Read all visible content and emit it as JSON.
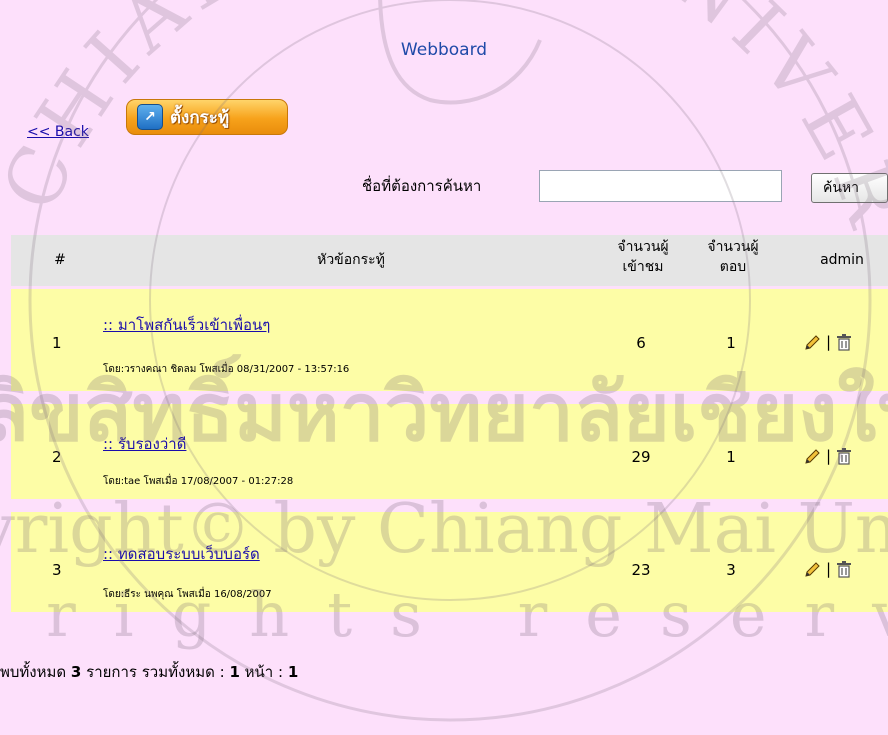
{
  "page": {
    "title": "Webboard",
    "back_label": "<< Back",
    "new_topic_label": "ตั้งกระทู้"
  },
  "search": {
    "label": "ชื่อที่ต้องการค้นหา",
    "value": "",
    "placeholder": "",
    "button_label": "ค้นหา"
  },
  "table": {
    "headers": {
      "number": "#",
      "topic": "หัวข้อกระทู้",
      "views_line1": "จำนวนผู้",
      "views_line2": "เข้าชม",
      "replies_line1": "จำนวนผู้",
      "replies_line2": "ตอบ",
      "admin": "admin"
    },
    "rows": [
      {
        "number": "1",
        "title": ":: มาโพสกันเร็วเข้าเพื่อนๆ",
        "meta": "โดย:วรางคณา ชิดลม โพสเมื่อ 08/31/2007 - 13:57:16",
        "views": "6",
        "replies": "1"
      },
      {
        "number": "2",
        "title": ":: รับรองว่าดี",
        "meta": "โดย:tae โพสเมื่อ 17/08/2007 - 01:27:28",
        "views": "29",
        "replies": "1"
      },
      {
        "number": "3",
        "title": ":: ทดสอบระบบเว็บบอร์ด",
        "meta": "โดย:ธีระ นพคุณ โพสเมื่อ 16/08/2007",
        "views": "23",
        "replies": "3"
      }
    ],
    "action_separator": "|"
  },
  "summary": {
    "prefix": "พบทั้งหมด",
    "count": "3",
    "mid": "รายการ รวมทั้งหมด :",
    "pages": "1",
    "page_word": "หน้า :",
    "current": "1"
  },
  "watermark": {
    "line1": "ลิขสิทธิ์มหาวิทยาลัยเชียงใหม่",
    "line2": "Copyright© by Chiang Mai University",
    "line3": "All rights reserved",
    "seal_text": "CHIANG MAI UNIVERSITY"
  },
  "colors": {
    "background": "#fde0fb",
    "row": "#fdfda6",
    "header": "#e5e5e5",
    "link": "#1a0dab",
    "title": "#1f4aa8"
  },
  "icons": {
    "edit": "pencil-icon",
    "delete": "trash-icon",
    "new_topic": "new-topic-icon"
  }
}
